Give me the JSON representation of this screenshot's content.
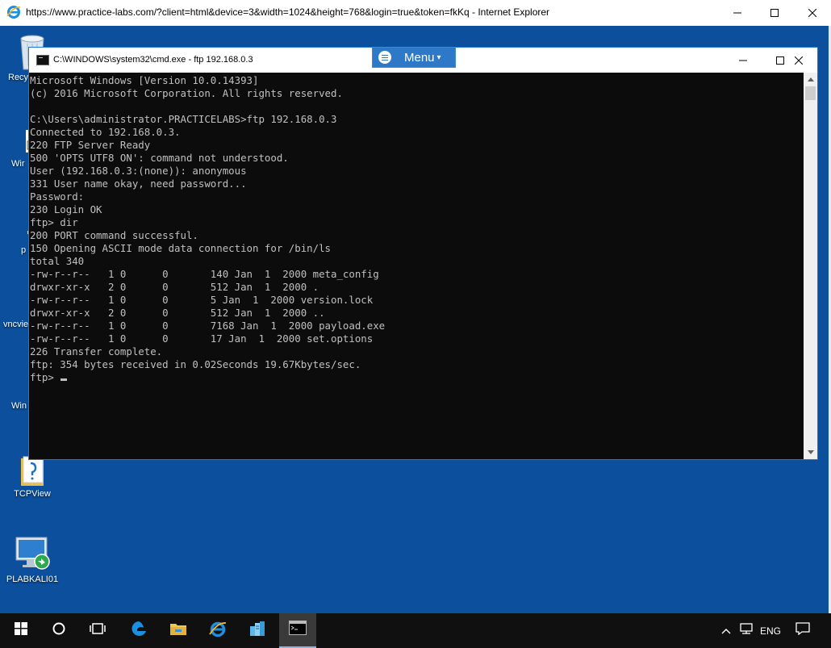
{
  "browser": {
    "title": "https://www.practice-labs.com/?client=html&device=3&width=1024&height=768&login=true&token=fkKq - Internet Explorer",
    "icon": "ie-icon",
    "controls": [
      "minimize",
      "maximize",
      "close"
    ]
  },
  "desktop": {
    "icons": [
      {
        "label": "Recy",
        "icon": "recycle-bin-icon"
      },
      {
        "label": "Wir",
        "icon": "shortcut-icon"
      },
      {
        "label": "p",
        "icon": "computer-icon"
      },
      {
        "label": "vncvie",
        "icon": "vnc-icon"
      },
      {
        "label": "Win",
        "icon": "document-icon"
      },
      {
        "label": "TCPView",
        "icon": "folder-icon"
      },
      {
        "label": "PLABKALI01",
        "icon": "remote-desktop-icon"
      }
    ]
  },
  "menu_button": {
    "label": "Menu",
    "caret": "▾",
    "icon": "hamburger-icon"
  },
  "cmd": {
    "title": "C:\\WINDOWS\\system32\\cmd.exe - ftp  192.168.0.3",
    "lines": [
      "Microsoft Windows [Version 10.0.14393]",
      "(c) 2016 Microsoft Corporation. All rights reserved.",
      "",
      "C:\\Users\\administrator.PRACTICELABS>ftp 192.168.0.3",
      "Connected to 192.168.0.3.",
      "220 FTP Server Ready",
      "500 'OPTS UTF8 ON': command not understood.",
      "User (192.168.0.3:(none)): anonymous",
      "331 User name okay, need password...",
      "Password:",
      "230 Login OK",
      "ftp> dir",
      "200 PORT command successful.",
      "150 Opening ASCII mode data connection for /bin/ls",
      "total 340",
      "-rw-r--r--   1 0      0       140 Jan  1  2000 meta_config",
      "drwxr-xr-x   2 0      0       512 Jan  1  2000 .",
      "-rw-r--r--   1 0      0       5 Jan  1  2000 version.lock",
      "drwxr-xr-x   2 0      0       512 Jan  1  2000 ..",
      "-rw-r--r--   1 0      0       7168 Jan  1  2000 payload.exe",
      "-rw-r--r--   1 0      0       17 Jan  1  2000 set.options",
      "226 Transfer complete.",
      "ftp: 354 bytes received in 0.02Seconds 19.67Kbytes/sec."
    ],
    "prompt": "ftp> "
  },
  "taskbar": {
    "items": [
      {
        "icon": "start-icon"
      },
      {
        "icon": "search-circle-icon"
      },
      {
        "icon": "task-view-icon"
      },
      {
        "icon": "edge-icon"
      },
      {
        "icon": "file-explorer-icon"
      },
      {
        "icon": "internet-explorer-icon"
      },
      {
        "icon": "server-manager-icon"
      },
      {
        "icon": "cmd-icon",
        "active": true
      }
    ],
    "tray": {
      "language": "ENG",
      "icons": [
        "chevron-up-icon",
        "network-icon",
        "notification-icon"
      ]
    }
  },
  "colors": {
    "desktop": "#0b4f9d",
    "console_bg": "#0c0c0c",
    "console_fg": "#c0c0c0",
    "taskbar": "#101010",
    "menu_button": "#2e79c7"
  }
}
